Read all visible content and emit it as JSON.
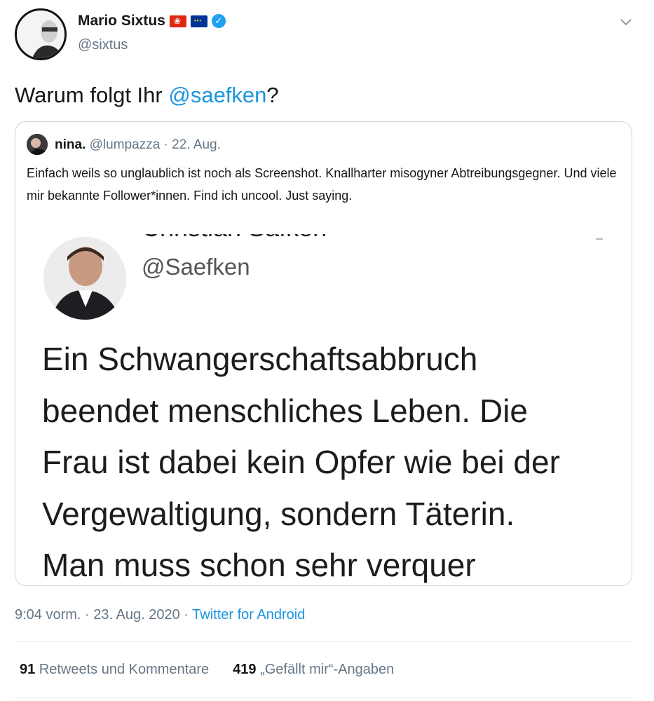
{
  "author": {
    "name": "Mario Sixtus",
    "handle": "@sixtus",
    "badges": [
      "hong-kong-flag-emoji",
      "eu-flag-emoji",
      "verified-icon"
    ]
  },
  "tweet": {
    "text_before": "Warum folgt Ihr ",
    "mention": "@saefken",
    "text_after": "?"
  },
  "quoted": {
    "name": "nina.",
    "handle": "@lumpazza",
    "separator": " · ",
    "date": "22. Aug.",
    "text": "Einfach weils so unglaublich ist noch als Screenshot. Knallharter misogyner Abtreibungsgegner. Und viele mir bekannte Follower*innen. Find ich uncool. Just saying.",
    "screenshot": {
      "cut_name": "Christian Säfken",
      "handle": "@Saefken",
      "lines": [
        "Ein Schwangerschaftsabbruch",
        "beendet menschliches Leben. Die",
        "Frau ist dabei kein Opfer wie bei der",
        "Vergewaltigung, sondern Täterin.",
        "Man muss schon sehr verquer"
      ]
    }
  },
  "meta": {
    "time": "9:04 vorm.",
    "sep1": " · ",
    "date": "23. Aug. 2020",
    "sep2": " · ",
    "source": "Twitter for Android"
  },
  "stats": {
    "retweets_count": "91",
    "retweets_label": " Retweets und Kommentare",
    "likes_count": "419",
    "likes_label": " „Gefällt mir“-Angaben"
  },
  "colors": {
    "link": "#1b95e0",
    "secondary": "#657786",
    "border": "#ccd6dd"
  }
}
